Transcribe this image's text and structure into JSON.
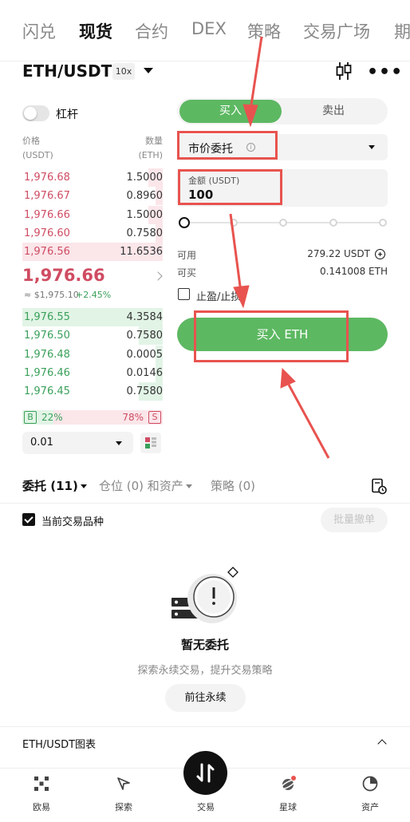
{
  "top_tabs": [
    "闪兑",
    "现货",
    "合约",
    "DEX",
    "策略",
    "交易广场",
    "期"
  ],
  "active_tab_index": 1,
  "pair": {
    "symbol": "ETH/USDT",
    "leverage": "10x"
  },
  "margin_toggle": {
    "label": "杠杆",
    "on": false
  },
  "orderbook": {
    "price_header": [
      "价格",
      "(USDT)"
    ],
    "qty_header": [
      "数量",
      "(ETH)"
    ],
    "asks": [
      {
        "price": "1,976.68",
        "qty": "1.5000",
        "depth": 0.1
      },
      {
        "price": "1,976.67",
        "qty": "0.8960",
        "depth": 0.05
      },
      {
        "price": "1,976.66",
        "qty": "1.5000",
        "depth": 0.1
      },
      {
        "price": "1,976.60",
        "qty": "0.7580",
        "depth": 0.05
      },
      {
        "price": "1,976.56",
        "qty": "11.6536",
        "depth": 1.0
      }
    ],
    "last_price": "1,976.66",
    "last_price_usd": "≈ $1,975.10",
    "change_pct": "+2.45%",
    "bids": [
      {
        "price": "1,976.55",
        "qty": "4.3584",
        "depth": 1.0
      },
      {
        "price": "1,976.50",
        "qty": "0.7580",
        "depth": 0.17
      },
      {
        "price": "1,976.48",
        "qty": "0.0005",
        "depth": 0.05
      },
      {
        "price": "1,976.46",
        "qty": "0.0146",
        "depth": 0.05
      },
      {
        "price": "1,976.45",
        "qty": "0.7580",
        "depth": 0.17
      }
    ],
    "buy_badge": "B",
    "buy_ratio": "22%",
    "sell_ratio": "78%",
    "sell_badge": "S",
    "precision": "0.01"
  },
  "order_form": {
    "buy_tab": "买入",
    "sell_tab": "卖出",
    "order_type": "市价委托",
    "amount_label": "金额 (USDT)",
    "amount_value": "100",
    "slider_percent": 0,
    "available_label": "可用",
    "available_value": "279.22 USDT",
    "can_buy_label": "可买",
    "can_buy_value": "0.141008 ETH",
    "tpsl_label": "止盈/止损",
    "buy_button": "买入 ETH"
  },
  "bottom_tabs": {
    "orders": "委托 (11)",
    "positions": "仓位 (0) 和资产",
    "strategy": "策略 (0)"
  },
  "current_only": {
    "label": "当前交易品种",
    "checked": true
  },
  "batch_cancel": "批量撤单",
  "empty_state": {
    "title": "暂无委托",
    "subtitle": "探索永续交易，提升交易策略",
    "button": "前往永续"
  },
  "chart_section": "ETH/USDT图表",
  "nav": [
    {
      "label": "欧易",
      "icon": "okx-logo-icon"
    },
    {
      "label": "探索",
      "icon": "compass-icon"
    },
    {
      "label": "交易",
      "icon": "trade-icon"
    },
    {
      "label": "星球",
      "icon": "planet-icon"
    },
    {
      "label": "资产",
      "icon": "pie-chart-icon"
    }
  ],
  "colors": {
    "ask": "#cf4c62",
    "bid": "#3aa05a",
    "buy_green": "#5db862",
    "annotation_red": "#e8534f"
  }
}
